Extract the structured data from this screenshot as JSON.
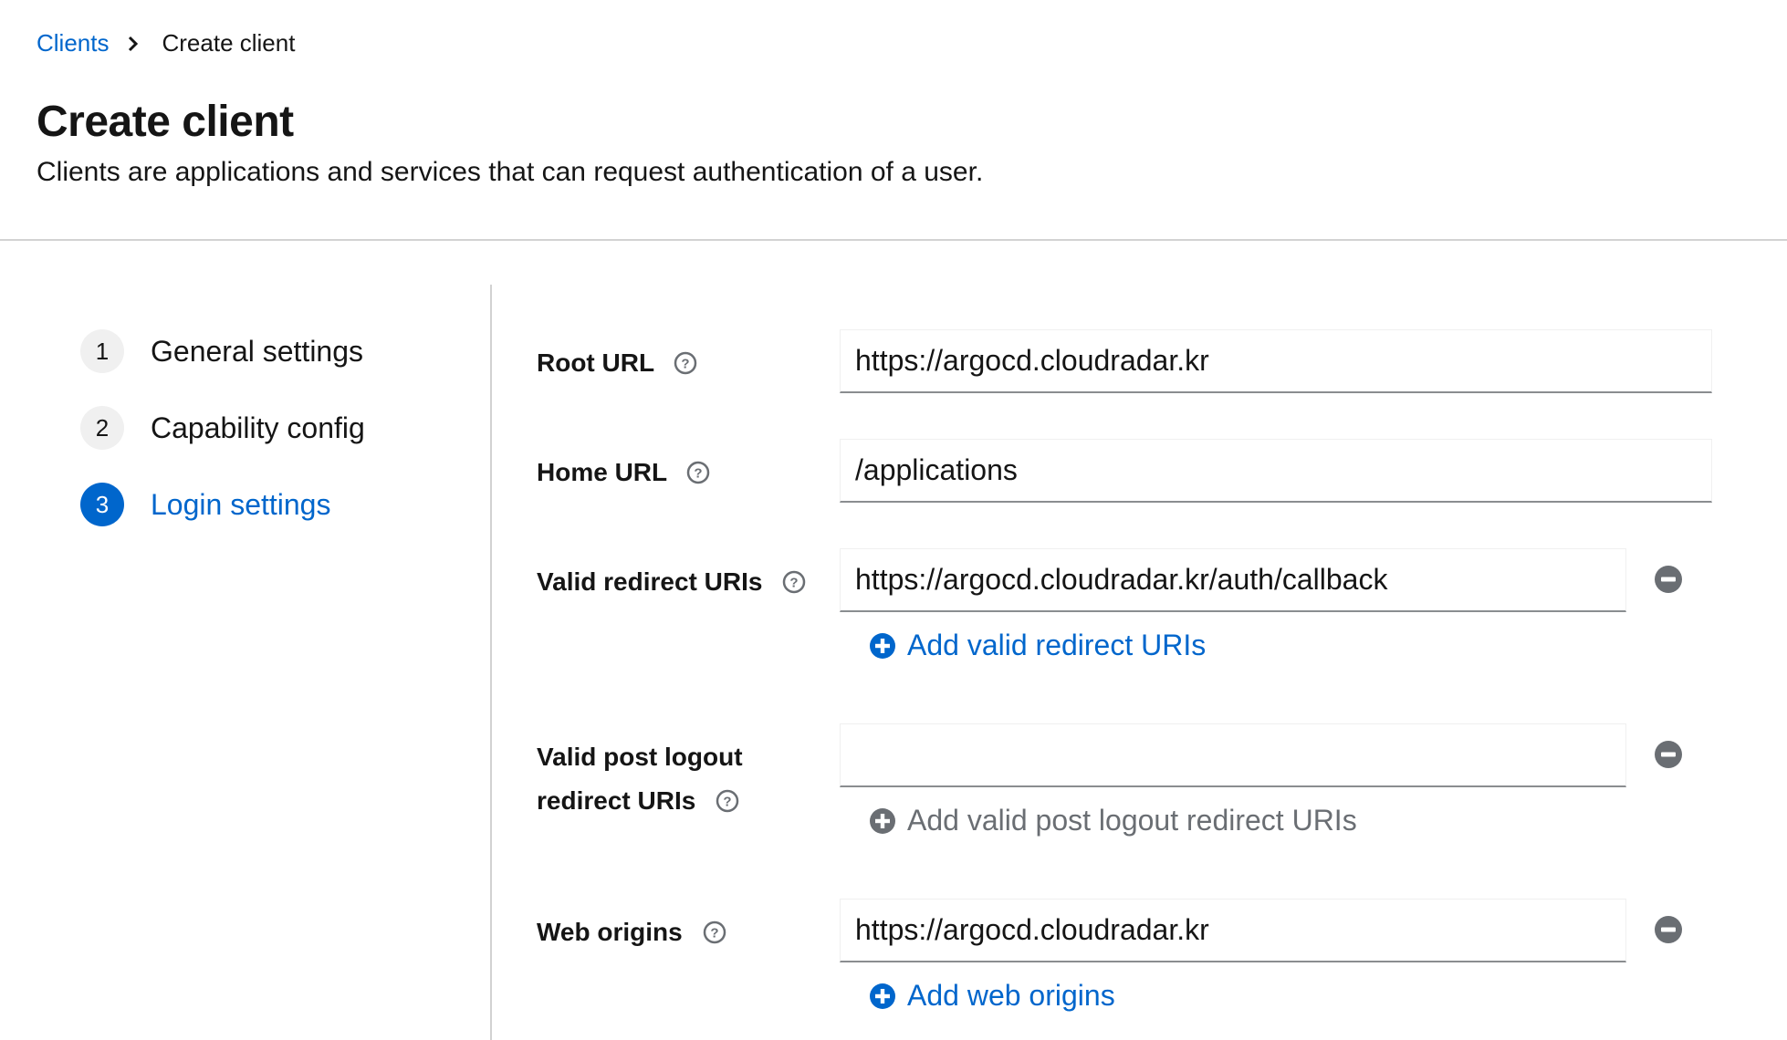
{
  "breadcrumb": {
    "parent": "Clients",
    "current": "Create client"
  },
  "header": {
    "title": "Create client",
    "description": "Clients are applications and services that can request authentication of a user."
  },
  "wizard": {
    "steps": [
      {
        "number": "1",
        "label": "General settings",
        "active": false
      },
      {
        "number": "2",
        "label": "Capability config",
        "active": false
      },
      {
        "number": "3",
        "label": "Login settings",
        "active": true
      }
    ]
  },
  "form": {
    "root_url": {
      "label": "Root URL",
      "value": "https://argocd.cloudradar.kr"
    },
    "home_url": {
      "label": "Home URL",
      "value": "/applications"
    },
    "valid_redirect_uris": {
      "label": "Valid redirect URIs",
      "value": "https://argocd.cloudradar.kr/auth/callback",
      "add_label": "Add valid redirect URIs"
    },
    "valid_post_logout": {
      "label_line1": "Valid post logout",
      "label_line2": "redirect URIs",
      "value": "",
      "add_label": "Add valid post logout redirect URIs"
    },
    "web_origins": {
      "label": "Web origins",
      "value": "https://argocd.cloudradar.kr",
      "add_label": "Add web origins"
    }
  },
  "colors": {
    "link": "#0066cc",
    "text": "#151515",
    "muted": "#6a6e73",
    "divider": "#d2d2d2",
    "icon_gray": "#6a6e73"
  },
  "icons": [
    "chevron-right-icon",
    "help-icon",
    "minus-circle-icon",
    "plus-circle-icon"
  ]
}
